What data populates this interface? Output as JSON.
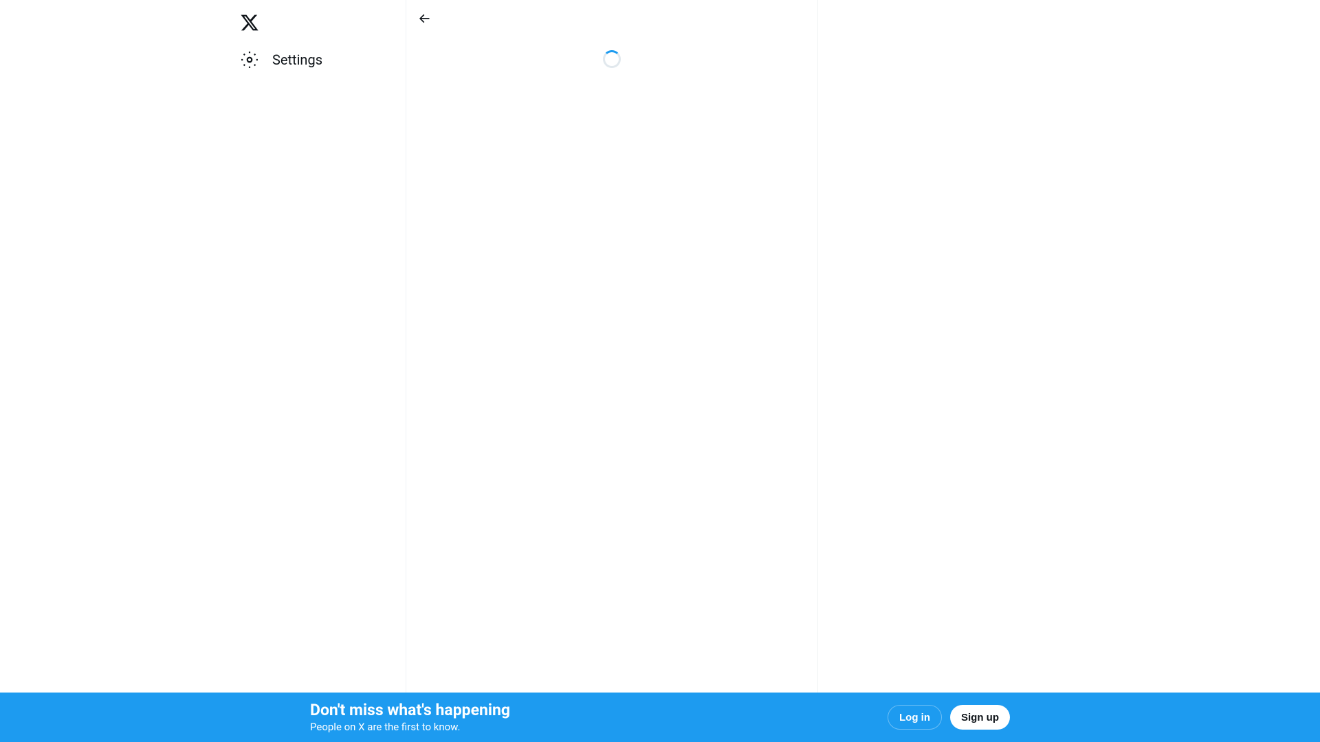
{
  "sidebar": {
    "items": [
      {
        "label": "Settings"
      }
    ]
  },
  "banner": {
    "title": "Don't miss what's happening",
    "subtitle": "People on X are the first to know.",
    "login_label": "Log in",
    "signup_label": "Sign up"
  }
}
